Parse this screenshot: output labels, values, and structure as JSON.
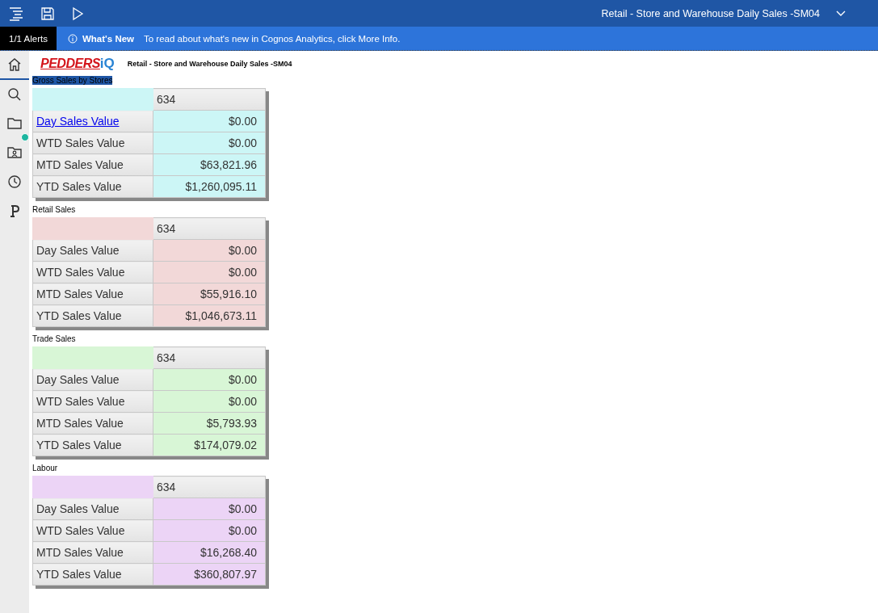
{
  "top_bar": {
    "report_title": "Retail - Store and Warehouse Daily Sales -SM04"
  },
  "alert_bar": {
    "alerts": "1/1 Alerts",
    "heading": "What's New",
    "message": "To read about what's new in Cognos Analytics, click More Info."
  },
  "sidebar": {
    "items": [
      {
        "selected": true,
        "badge": false
      },
      {
        "selected": false,
        "badge": false
      },
      {
        "selected": false,
        "badge": true
      },
      {
        "selected": false,
        "badge": false
      },
      {
        "selected": false,
        "badge": false
      },
      {
        "selected": false,
        "badge": false
      }
    ]
  },
  "report": {
    "logo": {
      "name": "PEDDERS",
      "suffix": "iQ"
    },
    "title": "Retail - Store and Warehouse Daily Sales -SM04",
    "tables": [
      {
        "title": "Gross Sales by Stores",
        "selected": true,
        "color": "#ccf6f6",
        "header": "634",
        "rows": [
          {
            "label": "Day Sales Value",
            "kind": "link",
            "value": "$0.00"
          },
          {
            "label": "WTD Sales Value",
            "kind": "text",
            "value": "$0.00"
          },
          {
            "label": "MTD Sales Value",
            "kind": "text",
            "value": "$63,821.96"
          },
          {
            "label": "YTD Sales Value",
            "kind": "text",
            "value": "$1,260,095.11"
          }
        ]
      },
      {
        "title": "Retail Sales",
        "selected": false,
        "color": "#f2d8d8",
        "header": "634",
        "rows": [
          {
            "label": "Day Sales Value",
            "kind": "text",
            "value": "$0.00"
          },
          {
            "label": "WTD Sales Value",
            "kind": "text",
            "value": "$0.00"
          },
          {
            "label": "MTD Sales Value",
            "kind": "text",
            "value": "$55,916.10"
          },
          {
            "label": "YTD Sales Value",
            "kind": "text",
            "value": "$1,046,673.11"
          }
        ]
      },
      {
        "title": "Trade Sales",
        "selected": false,
        "color": "#d8f6d6",
        "header": "634",
        "rows": [
          {
            "label": "Day Sales Value",
            "kind": "text",
            "value": "$0.00"
          },
          {
            "label": "WTD Sales Value",
            "kind": "text",
            "value": "$0.00"
          },
          {
            "label": "MTD Sales Value",
            "kind": "text",
            "value": "$5,793.93"
          },
          {
            "label": "YTD Sales Value",
            "kind": "text",
            "value": "$174,079.02"
          }
        ]
      },
      {
        "title": "Labour",
        "selected": false,
        "color": "#ecd4f6",
        "header": "634",
        "rows": [
          {
            "label": "Day Sales Value",
            "kind": "text",
            "value": "$0.00"
          },
          {
            "label": "WTD Sales Value",
            "kind": "text",
            "value": "$0.00"
          },
          {
            "label": "MTD Sales Value",
            "kind": "text",
            "value": "$16,268.40"
          },
          {
            "label": "YTD Sales Value",
            "kind": "text",
            "value": "$360,807.97"
          }
        ]
      }
    ]
  }
}
